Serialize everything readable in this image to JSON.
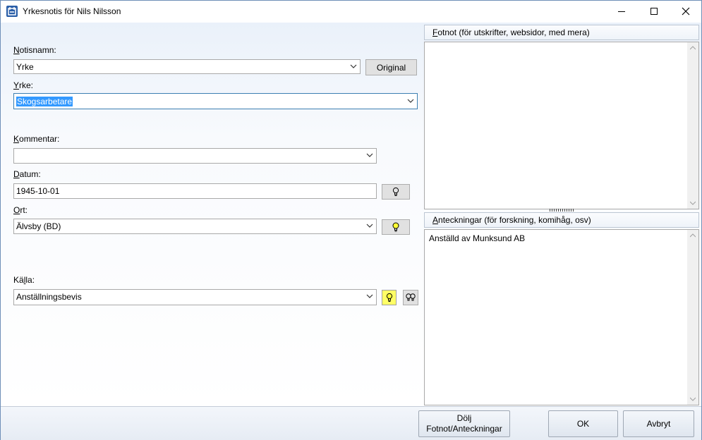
{
  "window": {
    "title": "Yrkesnotis för Nils Nilsson",
    "controls": [
      "minimize",
      "maximize",
      "close"
    ]
  },
  "form": {
    "notisnamn": {
      "label_first": "N",
      "label_rest": "otisnamn:",
      "value": "Yrke",
      "original_button": "Original"
    },
    "yrke": {
      "label_first": "Y",
      "label_rest": "rke:",
      "value": "Skogsarbetare"
    },
    "kommentar": {
      "label_first": "K",
      "label_rest": "ommentar:",
      "value": ""
    },
    "datum": {
      "label_first": "D",
      "label_rest": "atum:",
      "value": "1945-10-01"
    },
    "ort": {
      "label_first": "O",
      "label_rest": "rt:",
      "value": "Älvsby (BD)"
    },
    "kalla": {
      "label_first": "K",
      "label_rest": "ä",
      "label_under": "l",
      "label_end": "la:",
      "value": "Anställningsbevis"
    }
  },
  "panels": {
    "fotnot": {
      "header_first": "F",
      "header_rest": "otnot (för utskrifter, websidor, med mera)",
      "content": ""
    },
    "anteckningar": {
      "header_first": "A",
      "header_rest": "nteckningar (för forskning, komihåg, osv)",
      "content": "Anställd av Munksund AB"
    }
  },
  "footer": {
    "toggle_line1": "Dölj",
    "toggle_line2": "Fotnot/Anteckningar",
    "ok": "OK",
    "cancel": "Avbryt"
  },
  "colors": {
    "accent": "#3399ff",
    "highlight_button": "#ffff66",
    "app_icon": "#2b5fa8"
  }
}
